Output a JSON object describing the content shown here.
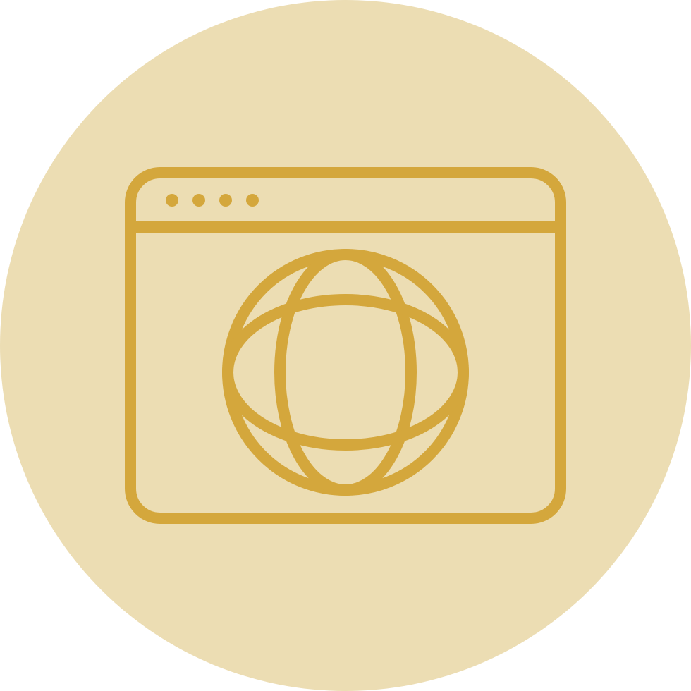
{
  "icon": {
    "name": "browser-globe-icon",
    "colors": {
      "background": "#ECDDB3",
      "stroke": "#D4A73C"
    }
  }
}
